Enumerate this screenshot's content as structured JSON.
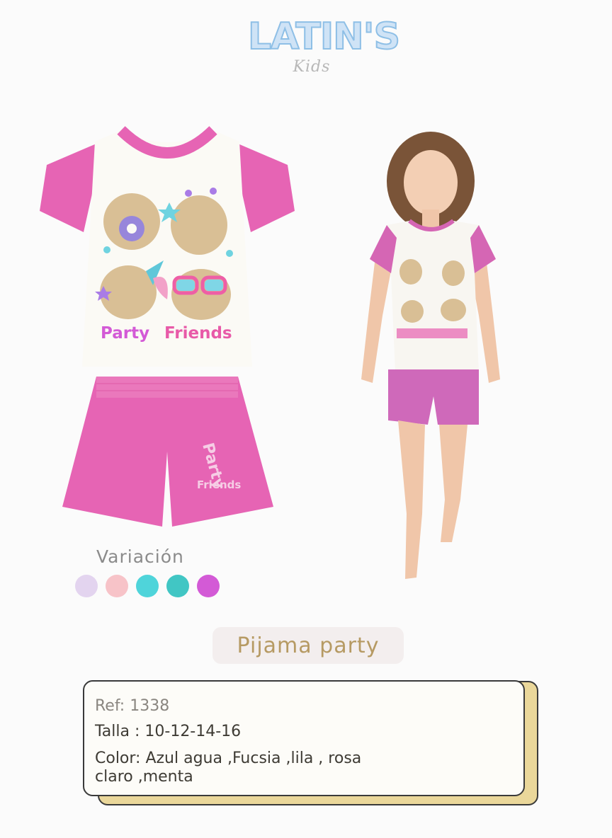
{
  "brand": {
    "name": "LATIN'S",
    "sub": "Kids"
  },
  "shirt_print": {
    "word1": "Party",
    "word2": "Friends"
  },
  "shorts_print": {
    "word1": "Party",
    "word2": "Friends"
  },
  "variation": {
    "label": "Variación",
    "swatches": [
      "#e3d4ef",
      "#f7c3c8",
      "#4fd4da",
      "#41c6c4",
      "#d35ad6"
    ]
  },
  "product_title": "Pijama party",
  "details": {
    "ref": "Ref: 1338",
    "talla": "Talla : 10-12-14-16",
    "color": "Color:  Azul agua ,Fucsia ,lila , rosa claro ,menta"
  },
  "colors": {
    "fuchsia": "#e664b4",
    "shirt_body": "#fbfaf5",
    "title_gold": "#b69a63"
  }
}
